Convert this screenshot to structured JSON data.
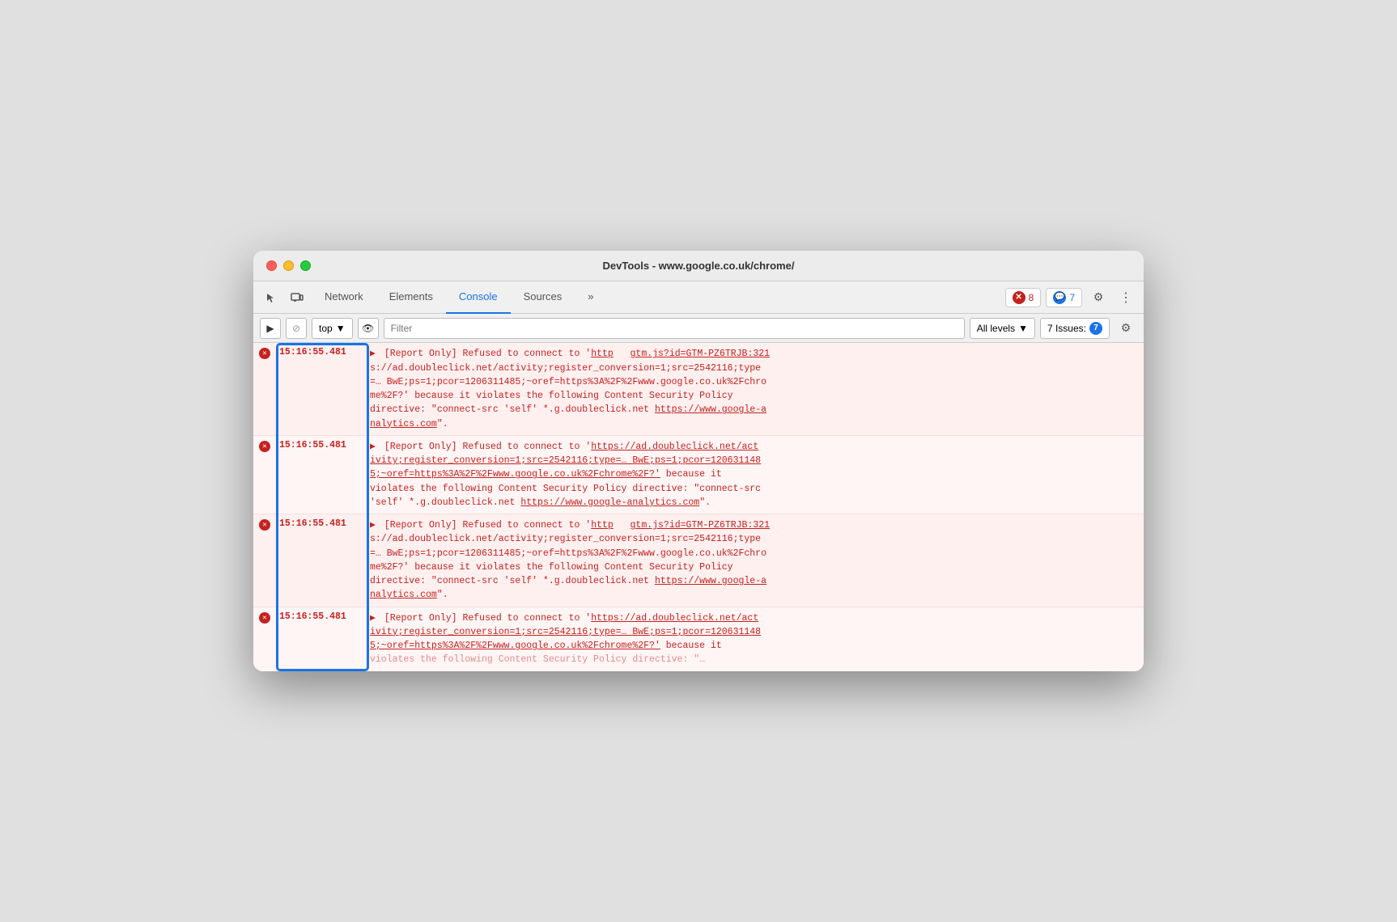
{
  "window": {
    "title": "DevTools - www.google.co.uk/chrome/"
  },
  "tabs": [
    {
      "label": "Network",
      "active": false
    },
    {
      "label": "Elements",
      "active": false
    },
    {
      "label": "Console",
      "active": true
    },
    {
      "label": "Sources",
      "active": false
    },
    {
      "label": "»",
      "active": false
    }
  ],
  "toolbar_right": {
    "error_count": "8",
    "info_count": "7",
    "gear_label": "⚙",
    "more_label": "⋮"
  },
  "console_toolbar": {
    "play_label": "▶",
    "stop_label": "⊘",
    "top_label": "top",
    "dropdown_arrow": "▼",
    "eye_label": "👁",
    "filter_placeholder": "Filter",
    "levels_label": "All levels",
    "issues_label": "7 Issues:",
    "issues_count": "7",
    "gear_label": "⚙"
  },
  "log_entries": [
    {
      "timestamp": "15:16:55.481",
      "message_parts": [
        "[Report Only] Refused to connect to '",
        "http",
        "  gtm.js?id=GTM-PZ6TRJB:321",
        "s://ad.doubleclick.net/activity;register_conversion=1;src=2542116;type",
        "=… BwE;ps=1;pcor=1206311485;~oref=https%3A%2F%2Fwww.google.co.uk%2Fchro",
        "me%2F?' because it violates the following Content Security Policy",
        "directive: \"connect-src 'self' *.g.doubleclick.net ",
        "https://www.google-analytics.com",
        "\"."
      ],
      "message": "[Report Only] Refused to connect to 'http  gtm.js?id=GTM-PZ6TRJB:321 s://ad.doubleclick.net/activity;register_conversion=1;src=2542116;type=… BwE;ps=1;pcor=1206311485;~oref=https%3A%2F%2Fwww.google.co.uk%2Fchrome%2F?' because it violates the following Content Security Policy directive: \"connect-src 'self' *.g.doubleclick.net https://www.google-analytics.com\"."
    },
    {
      "timestamp": "15:16:55.481",
      "message": "[Report Only] Refused to connect to 'https://ad.doubleclick.net/activity;register_conversion=1;src=2542116;type=… BwE;ps=1;pcor=1206311485;~oref=https%3A%2F%2Fwww.google.co.uk%2Fchrome%2F?' because it violates the following Content Security Policy directive: \"connect-src 'self' *.g.doubleclick.net https://www.google-analytics.com\"."
    },
    {
      "timestamp": "15:16:55.481",
      "message_parts": [
        "[Report Only] Refused to connect to '",
        "http",
        "  gtm.js?id=GTM-PZ6TRJB:321",
        "s://ad.doubleclick.net/activity;register_conversion=1;src=2542116;type",
        "=… BwE;ps=1;pcor=1206311485;~oref=https%3A%2F%2Fwww.google.co.uk%2Fchro",
        "me%2F?' because it violates the following Content Security Policy",
        "directive: \"connect-src 'self' *.g.doubleclick.net ",
        "https://www.google-analytics.com",
        "\"."
      ],
      "message": "[Report Only] Refused to connect to 'http  gtm.js?id=GTM-PZ6TRJB:321 s://ad.doubleclick.net/activity;register_conversion=1;src=2542116;type=… BwE;ps=1;pcor=1206311485;~oref=https%3A%2F%2Fwww.google.co.uk%2Fchrome%2F?' because it violates the following Content Security Policy directive: \"connect-src 'self' *.g.doubleclick.net https://www.google-analytics.com\"."
    },
    {
      "timestamp": "15:16:55.481",
      "message": "[Report Only] Refused to connect to 'https://ad.doubleclick.net/activity;register_conversion=1;src=2542116;type=… BwE;ps=1;pcor=1206311485;~oref=https%3A%2F%2Fwww.google.co.uk%2Fchrome%2F?' because it violates the following Content Security Policy directive: \"connect-src 'self' *.g.doubleclick.net https://www.google-analytics.com\"."
    }
  ]
}
